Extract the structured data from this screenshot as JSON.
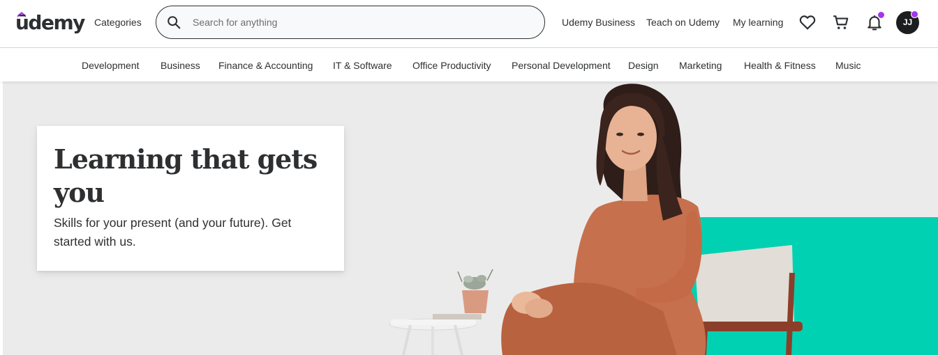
{
  "header": {
    "logo_text": "ūdemy",
    "categories_label": "Categories",
    "search": {
      "placeholder": "Search for anything",
      "value": ""
    },
    "links": {
      "business": "Udemy Business",
      "teach": "Teach on Udemy",
      "my_learning": "My learning"
    },
    "icons": [
      "heart-icon",
      "cart-icon",
      "bell-icon"
    ],
    "avatar_initials": "JJ",
    "notification_dot_color": "#a435f0"
  },
  "category_bar": {
    "items": [
      "Development",
      "Business",
      "Finance & Accounting",
      "IT & Software",
      "Office Productivity",
      "Personal Development",
      "Design",
      "Marketing",
      "Health & Fitness",
      "Music"
    ]
  },
  "hero": {
    "title": "Learning that gets you",
    "subtitle": "Skills for your present (and your future). Get started with us.",
    "accent_color": "#00d1b2"
  }
}
